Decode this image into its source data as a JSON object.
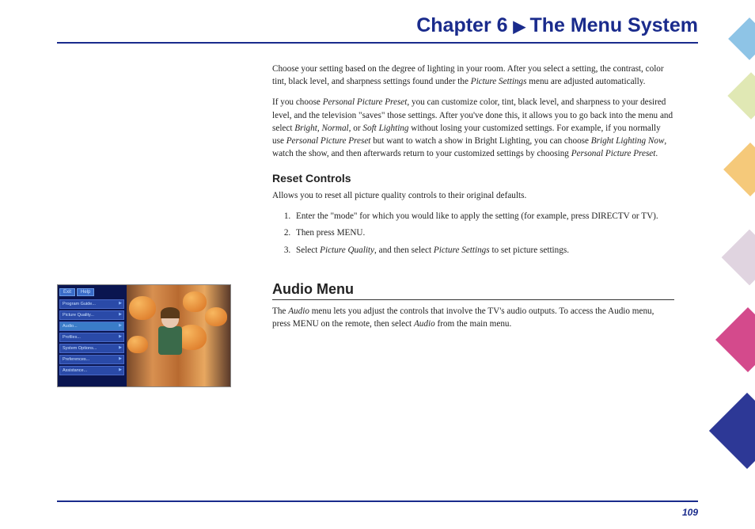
{
  "chapter": {
    "label": "Chapter 6",
    "title": "The Menu System"
  },
  "intro": {
    "p1_a": "Choose your setting based on the degree of lighting in your room. After you select a setting, the contrast, color tint, black level, and sharpness settings found under the ",
    "p1_i1": "Picture Settings",
    "p1_b": " menu are adjusted automatically.",
    "p2_a": "If you choose ",
    "p2_i1": "Personal Picture Preset",
    "p2_b": ", you can customize color, tint, black level, and sharpness to your desired level, and the television \"saves\" those settings. After you've done this, it allows you to go back into the menu and select ",
    "p2_i2": "Bright, Normal",
    "p2_c": ", or ",
    "p2_i3": "Soft Lighting",
    "p2_d": " without losing your customized settings. For example, if you normally use ",
    "p2_i4": "Personal Picture Preset",
    "p2_e": " but want to watch a show in Bright Lighting, you can choose ",
    "p2_i5": "Bright Lighting Now",
    "p2_f": ", watch the show, and then afterwards return to your customized settings by choosing ",
    "p2_i6": "Personal Picture Preset",
    "p2_g": "."
  },
  "reset": {
    "heading": "Reset Controls",
    "text": "Allows you to reset all picture quality controls to their original defaults.",
    "steps": {
      "s1": "Enter the \"mode\" for which you would like to apply the setting (for example, press DIRECTV or TV).",
      "s2": "Then press MENU.",
      "s3_a": "Select ",
      "s3_i1": "Picture Quality",
      "s3_b": ", and then select ",
      "s3_i2": "Picture Settings",
      "s3_c": " to set picture settings."
    }
  },
  "audio": {
    "heading": "Audio Menu",
    "p_a": "The ",
    "p_i1": "Audio",
    "p_b": " menu lets you adjust the controls that involve the TV's audio outputs. To access the Audio menu, press MENU on the remote, then select ",
    "p_i2": "Audio",
    "p_c": " from the main menu."
  },
  "tv_menu": {
    "top": {
      "exit": "Exit",
      "help": "Help"
    },
    "items": [
      "Program Guide...",
      "Picture Quality...",
      "Audio...",
      "Profiles...",
      "System Options...",
      "Preferences...",
      "Assistance..."
    ]
  },
  "page_number": "109"
}
